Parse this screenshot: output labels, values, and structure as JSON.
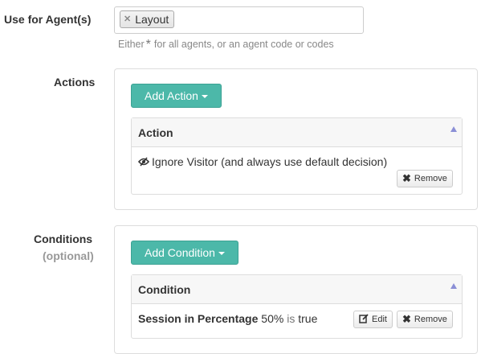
{
  "agents": {
    "label": "Use for Agent(s)",
    "tags": [
      "Layout"
    ],
    "help_prefix": "Either",
    "help_star": "*",
    "help_suffix": "for all agents, or an agent code or codes"
  },
  "actions": {
    "label": "Actions",
    "add_button": "Add Action",
    "table_header": "Action",
    "rows": [
      {
        "text": "Ignore Visitor (and always use default decision)",
        "remove_label": "Remove"
      }
    ]
  },
  "conditions": {
    "label": "Conditions",
    "sublabel": "(optional)",
    "add_button": "Add Condition",
    "table_header": "Condition",
    "rows": [
      {
        "name": "Session in Percentage",
        "value": "50%",
        "connector": "is",
        "state": "true",
        "edit_label": "Edit",
        "remove_label": "Remove"
      }
    ]
  },
  "icons": {
    "tag_remove": "x-icon",
    "eye_slash": "eye-slash-icon",
    "sort": "sort-up-icon",
    "remove": "remove-x-icon",
    "edit": "edit-icon",
    "caret": "caret-down-icon"
  },
  "colors": {
    "primary_button": "#4cb8a9",
    "sort_icon": "#8b8fd6"
  }
}
